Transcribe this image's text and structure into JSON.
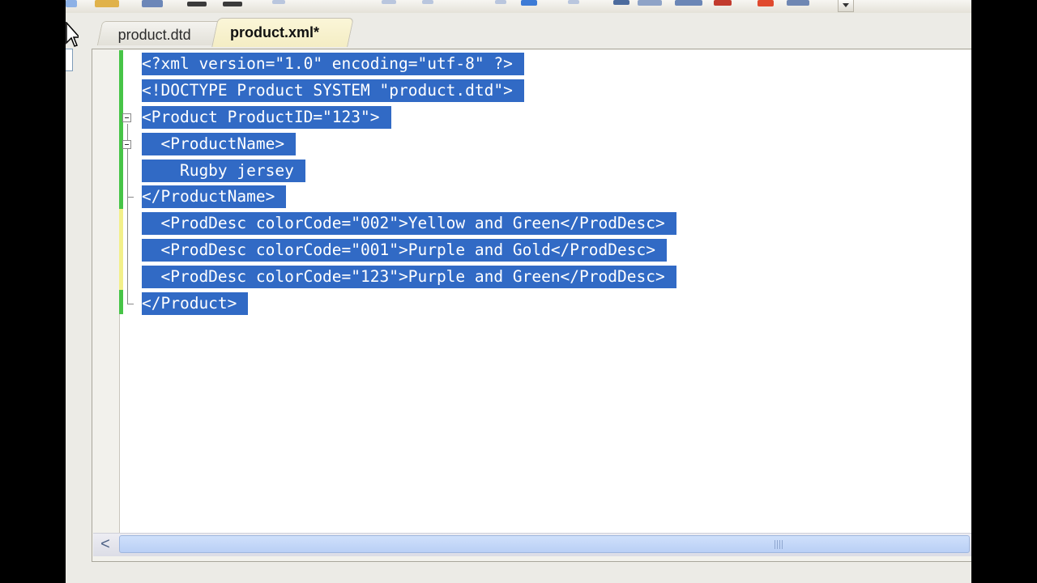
{
  "window": {
    "toolbar": {
      "overflow_button": "toolbar-overflow"
    }
  },
  "tabs": [
    {
      "label": "product.dtd",
      "active": false
    },
    {
      "label": "product.xml*",
      "active": true
    }
  ],
  "editor": {
    "selection_color": "#316ac5",
    "lines": [
      "<?xml version=\"1.0\" encoding=\"utf-8\" ?>",
      "<!DOCTYPE Product SYSTEM \"product.dtd\">",
      "<Product ProductID=\"123\">",
      "  <ProductName>",
      "    Rugby jersey",
      "</ProductName>",
      "  <ProdDesc colorCode=\"002\">Yellow and Green</ProdDesc>",
      "  <ProdDesc colorCode=\"001\">Purple and Gold</ProdDesc>",
      "  <ProdDesc colorCode=\"123\">Purple and Green</ProdDesc>",
      "</Product>"
    ]
  },
  "scrollbar": {
    "left_arrow": "<"
  }
}
